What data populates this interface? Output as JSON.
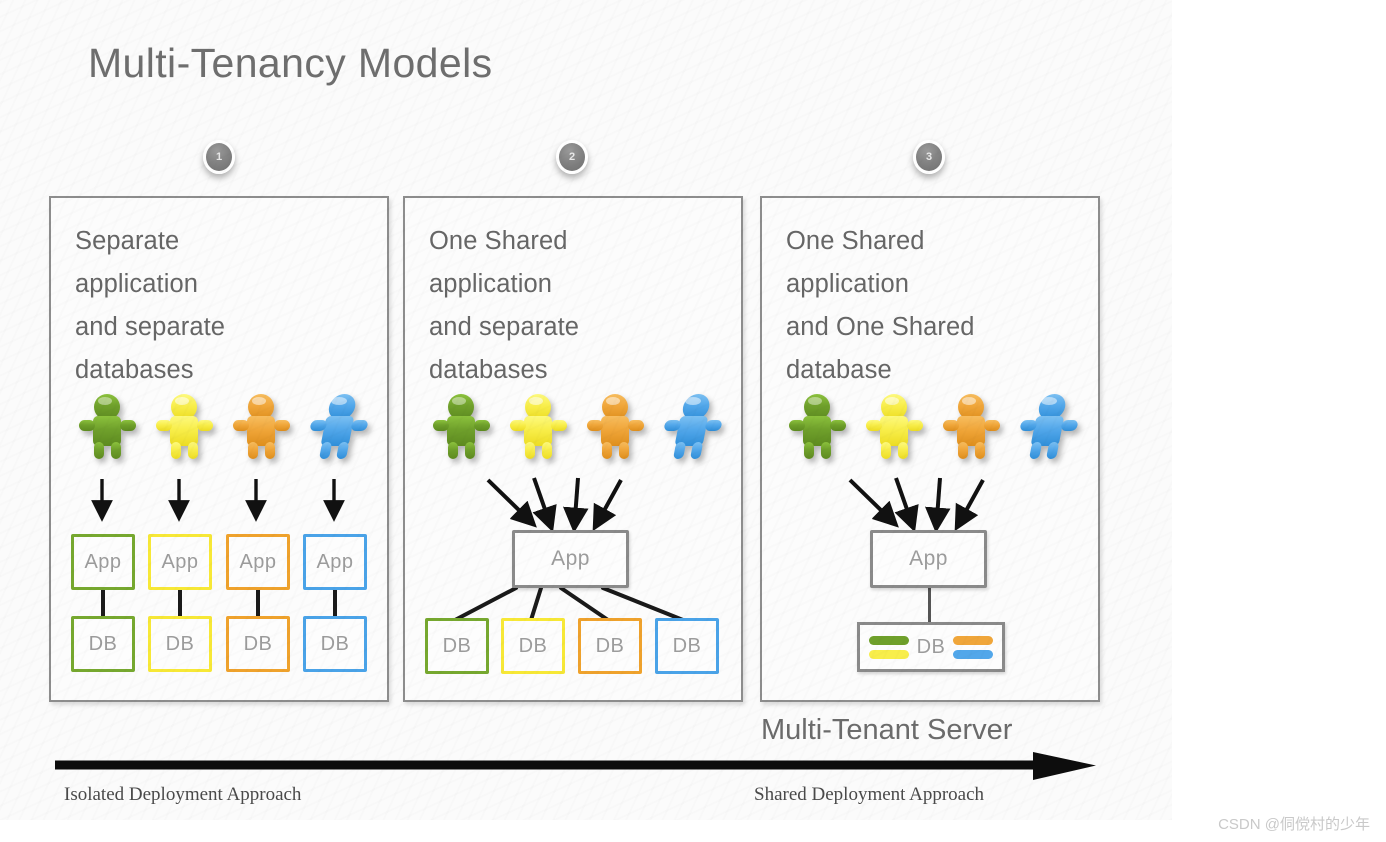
{
  "title": "Multi-Tenancy Models",
  "badges": [
    {
      "label": "1"
    },
    {
      "label": "2"
    },
    {
      "label": "3"
    }
  ],
  "panels": [
    {
      "id": "panel-1",
      "heading": "Separate\napplication\nand separate\ndatabases",
      "app_labels": [
        "App",
        "App",
        "App",
        "App"
      ],
      "db_labels": [
        "DB",
        "DB",
        "DB",
        "DB"
      ]
    },
    {
      "id": "panel-2",
      "heading": "One Shared\napplication\nand separate\ndatabases",
      "app_labels": [
        "App"
      ],
      "db_labels": [
        "DB",
        "DB",
        "DB",
        "DB"
      ]
    },
    {
      "id": "panel-3",
      "heading": "One Shared\napplication\nand One Shared\ndatabase",
      "app_labels": [
        "App"
      ],
      "db_labels": [
        "DB"
      ]
    }
  ],
  "tenant_colors": [
    "#6fa02b",
    "#f8ee4b",
    "#f0a63a",
    "#52a7ea"
  ],
  "box_colors": {
    "green": "#76a82f",
    "yellow": "#f7e836",
    "orange": "#efa22c",
    "blue": "#4aa3e8",
    "gray": "#8a8a8a"
  },
  "footer": {
    "multi_tenant_server": "Multi-Tenant Server",
    "isolated_approach": "Isolated Deployment Approach",
    "shared_approach": "Shared Deployment Approach"
  },
  "watermark": {
    "csdn": "CSDN @侗傥村的少年"
  }
}
